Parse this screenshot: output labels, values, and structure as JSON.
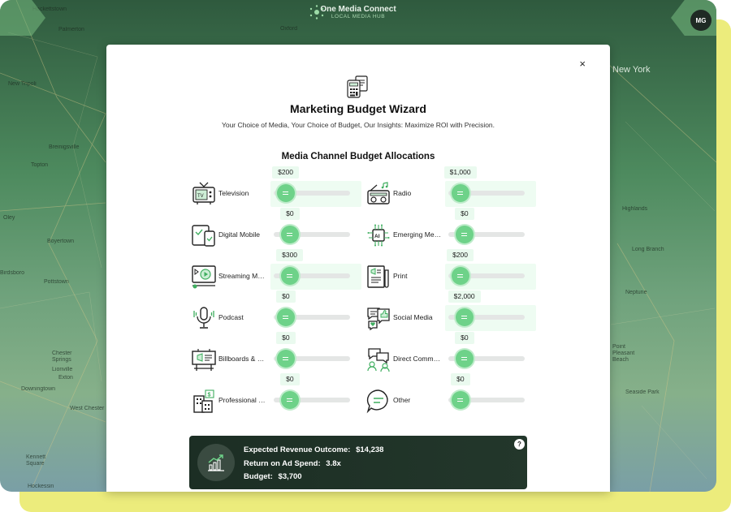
{
  "app": {
    "name": "One Media Connect",
    "subtitle": "LOCAL MEDIA HUB",
    "user_initials": "MG"
  },
  "map": {
    "labels": [
      {
        "text": "Hackettstown"
      },
      {
        "text": "Palmerton"
      },
      {
        "text": "New Tripoli"
      },
      {
        "text": "Breinigsville"
      },
      {
        "text": "Topton"
      },
      {
        "text": "Oley"
      },
      {
        "text": "Boyertown"
      },
      {
        "text": "Pottstown"
      },
      {
        "text": "Birdsboro"
      },
      {
        "text": "Chester Springs"
      },
      {
        "text": "Lionville"
      },
      {
        "text": "Exton"
      },
      {
        "text": "Downingtown"
      },
      {
        "text": "West Chester"
      },
      {
        "text": "Kennett Square"
      },
      {
        "text": "Hockessin"
      },
      {
        "text": "Oxford"
      },
      {
        "text": "New York"
      },
      {
        "text": "Highlands"
      },
      {
        "text": "Long Branch"
      },
      {
        "text": "Neptune"
      },
      {
        "text": "Point Pleasant Beach"
      },
      {
        "text": "Seaside Park"
      }
    ]
  },
  "modal": {
    "close_label": "×",
    "title": "Marketing Budget Wizard",
    "subtitle": "Your Choice of Media, Your Choice of Budget, Our Insights: Maximize ROI with Precision.",
    "section_title": "Media Channel Budget Allocations",
    "channels": [
      {
        "label": "Television",
        "amount": "$200",
        "icon": "television-icon",
        "level": 0.05
      },
      {
        "label": "Radio",
        "amount": "$1,000",
        "icon": "radio-icon",
        "level": 0.05
      },
      {
        "label": "Digital Mobile",
        "amount": "$0",
        "icon": "digital-mobile-icon",
        "level": 0.12
      },
      {
        "label": "Emerging Media",
        "amount": "$0",
        "icon": "ai-chip-icon",
        "level": 0.12
      },
      {
        "label": "Streaming Media",
        "amount": "$300",
        "icon": "streaming-icon",
        "level": 0.12
      },
      {
        "label": "Print",
        "amount": "$200",
        "icon": "print-icon",
        "level": 0.05
      },
      {
        "label": "Podcast",
        "amount": "$0",
        "icon": "microphone-icon",
        "level": 0.05
      },
      {
        "label": "Social Media",
        "amount": "$2,000",
        "icon": "social-media-icon",
        "level": 0.12
      },
      {
        "label": "Billboards & Outdoor",
        "amount": "$0",
        "icon": "billboard-icon",
        "level": 0.05
      },
      {
        "label": "Direct Communication",
        "amount": "$0",
        "icon": "direct-communication-icon",
        "level": 0.12
      },
      {
        "label": "Professional Services",
        "amount": "$0",
        "icon": "professional-icon",
        "level": 0.12
      },
      {
        "label": "Other",
        "amount": "$0",
        "icon": "other-chat-icon",
        "level": 0.05
      }
    ],
    "summary": {
      "revenue_label": "Expected Revenue Outcome:",
      "revenue_value": "$14,238",
      "roas_label": "Return on Ad Spend:",
      "roas_value": "3.8x",
      "budget_label": "Budget:",
      "budget_value": "$3,700",
      "help_label": "?"
    }
  },
  "colors": {
    "accent": "#6ed289",
    "dark_panel": "#1c2e24",
    "highlight_yellow": "#ecec7c"
  }
}
